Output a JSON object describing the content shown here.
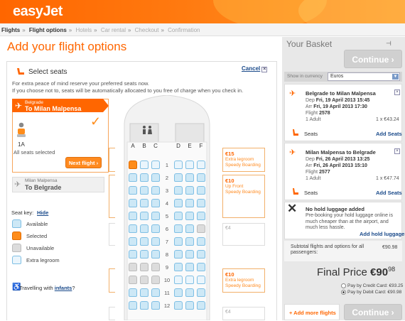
{
  "brand": {
    "logo": "easyJet",
    "accent": "#ff6600"
  },
  "breadcrumb": [
    {
      "label": "Flights",
      "active": true
    },
    {
      "label": "Flight options",
      "active": true
    },
    {
      "label": "Hotels",
      "active": false
    },
    {
      "label": "Car rental",
      "active": false
    },
    {
      "label": "Checkout",
      "active": false
    },
    {
      "label": "Confirmation",
      "active": false
    }
  ],
  "page_title": "Add your flight options",
  "seats_panel": {
    "title": "Select seats",
    "cancel": "Cancel",
    "intro1": "For extra peace of mind reserve your preferred seats now.",
    "intro2": "If you choose not to, seats will be automatically allocated to you free of charge when you check in.",
    "flight1": {
      "from": "Belgrade",
      "to": "To Milan Malpensa",
      "seat": "1A",
      "status": "All seats selected",
      "next": "Next flight"
    },
    "flight2": {
      "from": "Milan Malpensa",
      "to": "To Belgrade"
    },
    "key": {
      "label": "Seat key:",
      "hide": "Hide",
      "available": "Available",
      "selected": "Selected",
      "unavailable": "Unavailable",
      "extra": "Extra legroom"
    },
    "travel_prefix": "Travelling with ",
    "travel_link": "infants",
    "travel_suffix": "?"
  },
  "seatmap": {
    "columns": [
      "A",
      "B",
      "C",
      "D",
      "E",
      "F"
    ],
    "rows": [
      "1",
      "2",
      "3",
      "4",
      "5",
      "6",
      "7",
      "8",
      "9",
      "10",
      "11",
      "12"
    ],
    "price_boxes": [
      {
        "price": "€15",
        "line1": "Extra legroom",
        "line2": "Speedy Boarding"
      },
      {
        "price": "€10",
        "line1": "Up Front",
        "line2": "Speedy Boarding"
      },
      {
        "price": "€4"
      },
      {
        "price": "€10",
        "line1": "Extra legroom",
        "line2": "Speedy Boarding"
      },
      {
        "price": "€4"
      }
    ]
  },
  "basket": {
    "title": "Your Basket",
    "continue": "Continue",
    "currency_label": "Show in currency",
    "currency": "Euros",
    "flights": [
      {
        "route": "Belgrade to Milan Malpensa",
        "dep_label": "Dep",
        "dep": "Fri, 19 April 2013 15:45",
        "arr_label": "Arr",
        "arr": "Fri, 19 April 2013 17:30",
        "flight_label": "Flight",
        "flight": "2578",
        "pax": "1 Adult",
        "price": "1 x €43.24",
        "seats": "Seats",
        "add_seats": "Add Seats"
      },
      {
        "route": "Milan Malpensa to Belgrade",
        "dep_label": "Dep",
        "dep": "Fri, 26 April 2013 13:25",
        "arr_label": "Arr",
        "arr": "Fri, 26 April 2013 15:10",
        "flight_label": "Flight",
        "flight": "2577",
        "pax": "1 Adult",
        "price": "1 x €47.74",
        "seats": "Seats",
        "add_seats": "Add Seats"
      }
    ],
    "luggage": {
      "title": "No hold luggage added",
      "text": "Pre-booking your hold luggage online is much cheaper than at the airport, and much less hassle.",
      "add": "Add hold luggage"
    },
    "subtotal_label": "Subtotal flights and options for all passengers:",
    "subtotal": "€90.98",
    "final_label": "Final Price",
    "final_amount": "€90",
    "final_cents": "98",
    "pay_credit": "Pay by Credit Card: €93.25",
    "pay_debit": "Pay by Debit Card: €90.98",
    "add_more": "+ Add more flights"
  }
}
